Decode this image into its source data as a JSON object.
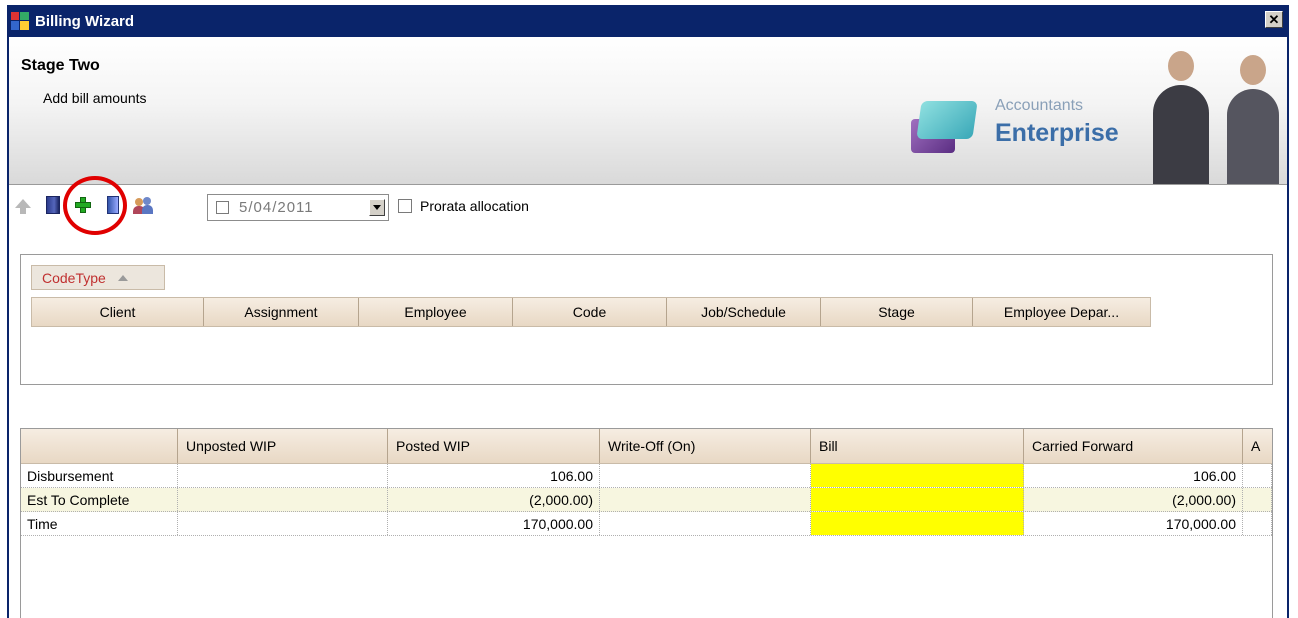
{
  "window": {
    "title": "Billing Wizard",
    "close_symbol": "✕"
  },
  "header": {
    "stage_title": "Stage Two",
    "stage_subtitle": "Add bill amounts",
    "logo_top": "Accountants",
    "logo_bottom": "Enterprise"
  },
  "toolbar": {
    "icons": [
      "move-up-icon",
      "book-icon",
      "add-icon",
      "book-blue-icon",
      "people-icon"
    ],
    "date_value": "5/04/2011",
    "prorata_label": "Prorata allocation"
  },
  "group_panel": {
    "group_by_label": "CodeType",
    "columns": [
      "Client",
      "Assignment",
      "Employee",
      "Code",
      "Job/Schedule",
      "Stage",
      "Employee Depar..."
    ]
  },
  "grid": {
    "columns": [
      "",
      "Unposted WIP",
      "Posted WIP",
      "Write-Off (On)",
      "Bill",
      "Carried Forward",
      "A"
    ],
    "rows": [
      {
        "label": "Disbursement",
        "unposted": "",
        "posted": "106.00",
        "writeoff": "",
        "bill": "",
        "carried": "106.00"
      },
      {
        "label": "Est To Complete",
        "unposted": "",
        "posted": "(2,000.00)",
        "writeoff": "",
        "bill": "",
        "carried": "(2,000.00)"
      },
      {
        "label": "Time",
        "unposted": "",
        "posted": "170,000.00",
        "writeoff": "",
        "bill": "",
        "carried": "170,000.00"
      }
    ]
  },
  "colors": {
    "titlebar": "#0a246a",
    "bill_highlight": "#ffff00",
    "annotation_circle": "#e00000",
    "group_label": "#c03030"
  }
}
